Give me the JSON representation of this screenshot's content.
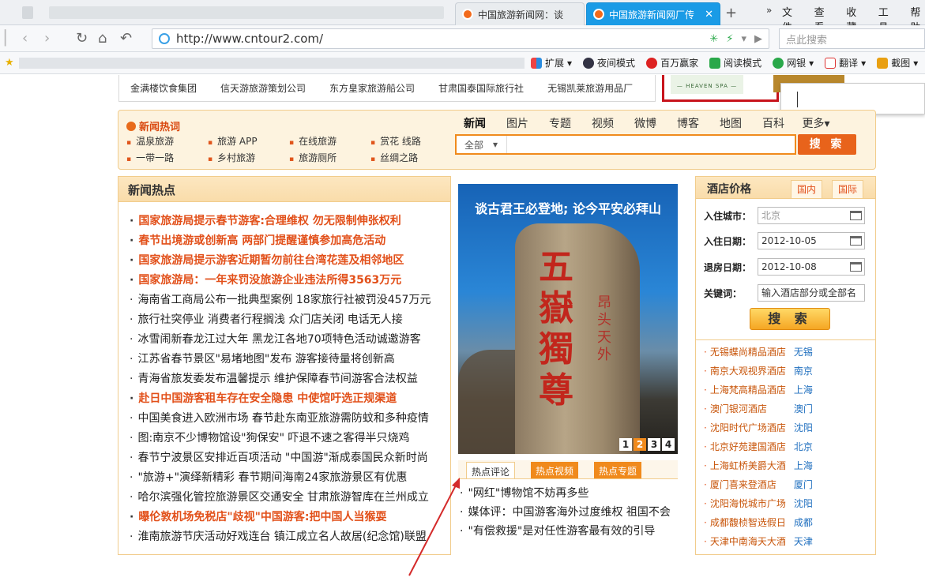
{
  "browser": {
    "tabs": [
      {
        "title": "中国旅游新闻网：谈",
        "active": false
      },
      {
        "title": "中国旅游新闻网厂传",
        "active": true
      }
    ],
    "new_tab": "+",
    "overflow": "»",
    "menu": [
      "文件",
      "查看",
      "收藏",
      "工具",
      "帮助"
    ],
    "url": "http://www.cntour2.com/",
    "search_placeholder": "点此搜索",
    "bookmarks": [
      "扩展",
      "夜间模式",
      "百万赢家",
      "阅读模式",
      "网银",
      "翻译",
      "截图"
    ]
  },
  "toplinks": [
    "金满楼饮食集团",
    "信天游旅游策划公司",
    "东方皇家旅游船公司",
    "甘肃国泰国际旅行社",
    "无锡凯莱旅游用品厂"
  ],
  "ad": {
    "text": "— HEAVEN SPA —"
  },
  "hot": {
    "title": "新闻热词",
    "words": [
      "温泉旅游",
      "旅游 APP",
      "在线旅游",
      "赏花 线路",
      "一带一路",
      "乡村旅游",
      "旅游厕所",
      "丝绸之路"
    ]
  },
  "search": {
    "tabs": [
      "新闻",
      "图片",
      "专题",
      "视频",
      "微博",
      "博客",
      "地图",
      "百科",
      "更多▾"
    ],
    "scope": "全部",
    "button": "搜 索"
  },
  "news": {
    "title": "新闻热点",
    "items": [
      {
        "text": "国家旅游局提示春节游客:合理维权 勿无限制伸张权利",
        "hl": true
      },
      {
        "text": "春节出境游或创新高 两部门提醒谨慎参加高危活动",
        "hl": true
      },
      {
        "text": "国家旅游局提示游客近期暂勿前往台湾花莲及相邻地区",
        "hl": true
      },
      {
        "text": "国家旅游局：一年来罚没旅游企业违法所得3563万元",
        "hl": true
      },
      {
        "text": "海南省工商局公布一批典型案例 18家旅行社被罚没457万元",
        "hl": false
      },
      {
        "text": "旅行社突停业 消费者行程搁浅 众门店关闭 电话无人接",
        "hl": false
      },
      {
        "text": "冰雪闹新春龙江过大年 黑龙江各地70项特色活动诚邀游客",
        "hl": false
      },
      {
        "text": "江苏省春节景区\"易堵地图\"发布 游客接待量将创新高",
        "hl": false
      },
      {
        "text": "青海省旅发委发布温馨提示 维护保障春节间游客合法权益",
        "hl": false
      },
      {
        "text": "赴日中国游客租车存在安全隐患 中使馆吁选正规渠道",
        "hl": true
      },
      {
        "text": "中国美食进入欧洲市场 春节赴东南亚旅游需防蚊和多种疫情",
        "hl": false
      },
      {
        "text": "图:南京不少博物馆设\"狗保安\" 吓退不速之客得半只烧鸡",
        "hl": false
      },
      {
        "text": "春节宁波景区安排近百项活动 \"中国游\"渐成泰国民众新时尚",
        "hl": false
      },
      {
        "text": "\"旅游+\"演绎新精彩 春节期间海南24家旅游景区有优惠",
        "hl": false
      },
      {
        "text": "哈尔滨强化管控旅游景区交通安全 甘肃旅游智库在兰州成立",
        "hl": false
      },
      {
        "text": "曝伦敦机场免税店\"歧视\"中国游客:把中国人当猴耍",
        "hl": true
      },
      {
        "text": "淮南旅游节庆活动好戏连台 镇江成立名人故居(纪念馆)联盟",
        "hl": false
      }
    ]
  },
  "feature": {
    "caption": "谈古君王必登地; 论今平安必拜山",
    "big_chars": [
      "五",
      "嶽",
      "獨",
      "尊"
    ],
    "small_chars": [
      "昂",
      "头",
      "天",
      "外"
    ],
    "pages": [
      "1",
      "2",
      "3",
      "4"
    ],
    "active_page": 1,
    "comment_tabs": [
      "热点评论",
      "热点视频",
      "热点专题"
    ],
    "comments": [
      "\"网红\"博物馆不妨再多些",
      "媒体评：中国游客海外过度维权 祖国不会",
      "\"有偿救援\"是对任性游客最有效的引导"
    ]
  },
  "hotel": {
    "title": "酒店价格",
    "tabs": [
      "国内",
      "国际"
    ],
    "fields": [
      {
        "label": "入住城市：",
        "value": "北京",
        "placeholder": true,
        "calendar": true
      },
      {
        "label": "入住日期：",
        "value": "2012-10-05",
        "placeholder": false,
        "calendar": true
      },
      {
        "label": "退房日期：",
        "value": "2012-10-08",
        "placeholder": false,
        "calendar": true
      },
      {
        "label": "关键词：",
        "value": "输入酒店部分或全部名",
        "placeholder": false,
        "calendar": false
      }
    ],
    "button": "搜 索",
    "list": [
      {
        "name": "无锡蝶尚精品酒店",
        "city": "无锡"
      },
      {
        "name": "南京大观视界酒店",
        "city": "南京"
      },
      {
        "name": "上海梵高精品酒店",
        "city": "上海"
      },
      {
        "name": "澳门银河酒店",
        "city": "澳门"
      },
      {
        "name": "沈阳时代广场酒店",
        "city": "沈阳"
      },
      {
        "name": "北京好苑建国酒店",
        "city": "北京"
      },
      {
        "name": "上海虹桥美爵大酒",
        "city": "上海"
      },
      {
        "name": "厦门喜来登酒店",
        "city": "厦门"
      },
      {
        "name": "沈阳海悦城市广场",
        "city": "沈阳"
      },
      {
        "name": "成都馥桢智选假日",
        "city": "成都"
      },
      {
        "name": "天津中南海天大酒",
        "city": "天津"
      }
    ]
  }
}
